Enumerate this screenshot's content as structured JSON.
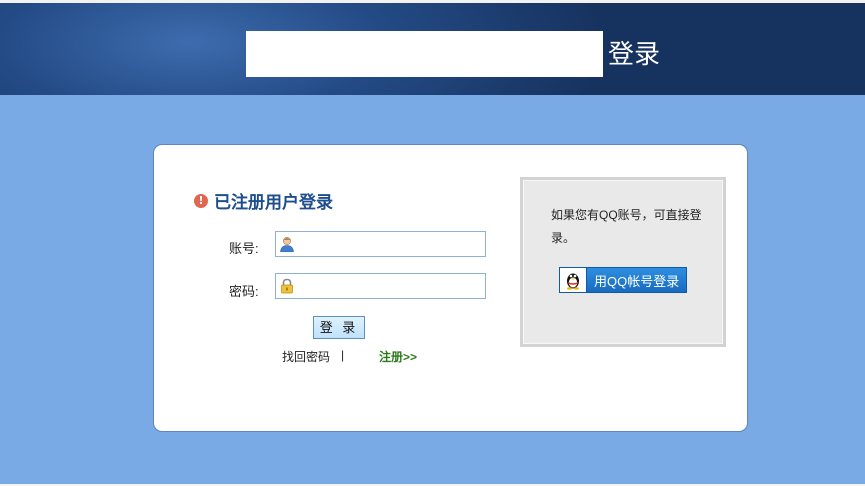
{
  "header": {
    "title": "登录"
  },
  "login": {
    "section_title": "已注册用户登录",
    "account_label": "账号:",
    "account_value": "",
    "password_label": "密码:",
    "password_value": "",
    "submit_label": "登 录",
    "forgot_label": "找回密码",
    "separator": "|",
    "register_label": "注册>>"
  },
  "qq": {
    "prompt": "如果您有QQ账号，可直接登录。",
    "button_label": "用QQ帐号登录"
  },
  "icons": {
    "warning": "alert-circle-icon",
    "user": "user-icon",
    "lock": "lock-icon",
    "qq": "qq-penguin-icon"
  },
  "colors": {
    "page_bg": "#7aaae6",
    "header_bg": "#1b3c70",
    "title_blue": "#1e4e8c",
    "register_green": "#2c7a1a",
    "qq_button": "#1e78cc"
  }
}
